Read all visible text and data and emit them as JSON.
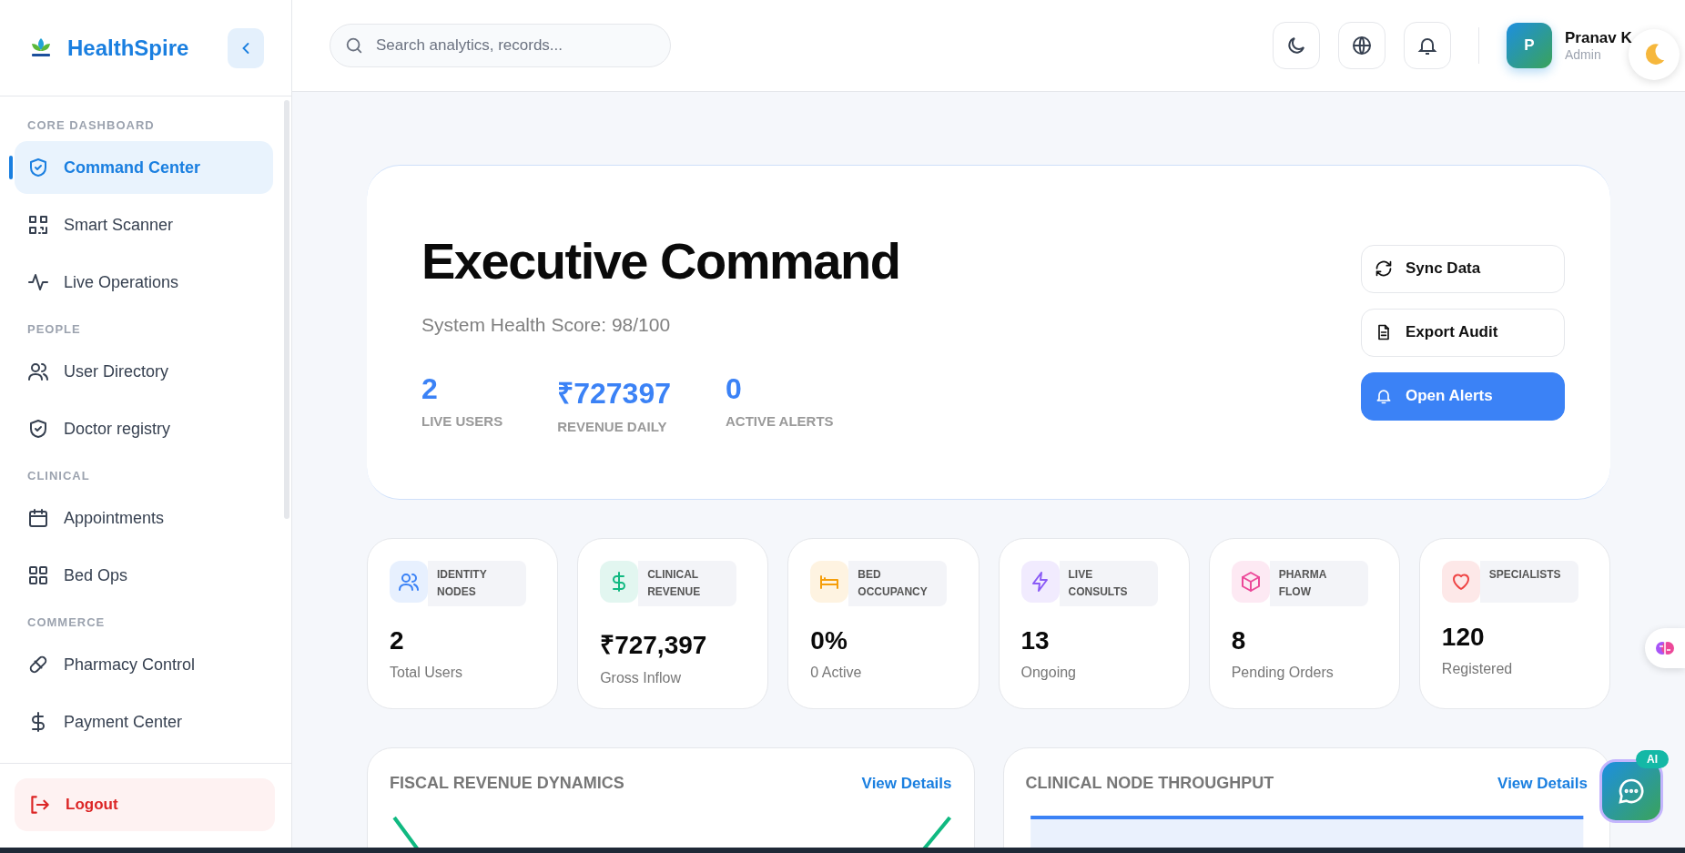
{
  "brand": {
    "name": "HealthSpire"
  },
  "sidebar": {
    "sections": [
      {
        "label": "CORE DASHBOARD",
        "items": [
          {
            "label": "Command Center",
            "selected": true
          },
          {
            "label": "Smart Scanner",
            "selected": false
          },
          {
            "label": "Live Operations",
            "selected": false
          }
        ]
      },
      {
        "label": "PEOPLE",
        "items": [
          {
            "label": "User Directory",
            "selected": false
          },
          {
            "label": "Doctor registry",
            "selected": false
          }
        ]
      },
      {
        "label": "CLINICAL",
        "items": [
          {
            "label": "Appointments",
            "selected": false
          },
          {
            "label": "Bed Ops",
            "selected": false
          }
        ]
      },
      {
        "label": "COMMERCE",
        "items": [
          {
            "label": "Pharmacy Control",
            "selected": false
          },
          {
            "label": "Payment Center",
            "selected": false
          }
        ]
      }
    ],
    "logout": "Logout"
  },
  "header": {
    "search": {
      "placeholder": "Search analytics, records..."
    },
    "user": {
      "initial": "P",
      "name": "Pranav K",
      "role": "Admin"
    }
  },
  "hero": {
    "title": "Executive Command",
    "subtitle": "System Health Score: 98/100",
    "metrics": [
      {
        "value": "2",
        "label": "LIVE USERS"
      },
      {
        "value": "₹727397",
        "label": "REVENUE DAILY"
      },
      {
        "value": "0",
        "label": "ACTIVE ALERTS"
      }
    ],
    "actions": [
      {
        "label": "Sync Data",
        "primary": false
      },
      {
        "label": "Export Audit",
        "primary": false
      },
      {
        "label": "Open Alerts",
        "primary": true
      }
    ]
  },
  "stats": [
    {
      "tag": "IDENTITY NODES",
      "value": "2",
      "caption": "Total Users",
      "color": "#3b82f6"
    },
    {
      "tag": "CLINICAL REVENUE",
      "value": "₹727,397",
      "caption": "Gross Inflow",
      "color": "#10b981"
    },
    {
      "tag": "BED OCCUPANCY",
      "value": "0%",
      "caption": "0 Active",
      "color": "#f59e0b"
    },
    {
      "tag": "LIVE CONSULTS",
      "value": "13",
      "caption": "Ongoing",
      "color": "#8b5cf6"
    },
    {
      "tag": "PHARMA FLOW",
      "value": "8",
      "caption": "Pending Orders",
      "color": "#ec4899"
    },
    {
      "tag": "SPECIALISTS",
      "value": "120",
      "caption": "Registered",
      "color": "#ef4444"
    }
  ],
  "panels": [
    {
      "title": "FISCAL REVENUE DYNAMICS",
      "link": "View Details",
      "kind": "line"
    },
    {
      "title": "CLINICAL NODE THROUGHPUT",
      "link": "View Details",
      "kind": "area"
    }
  ],
  "assistant": {
    "badge": "AI"
  }
}
